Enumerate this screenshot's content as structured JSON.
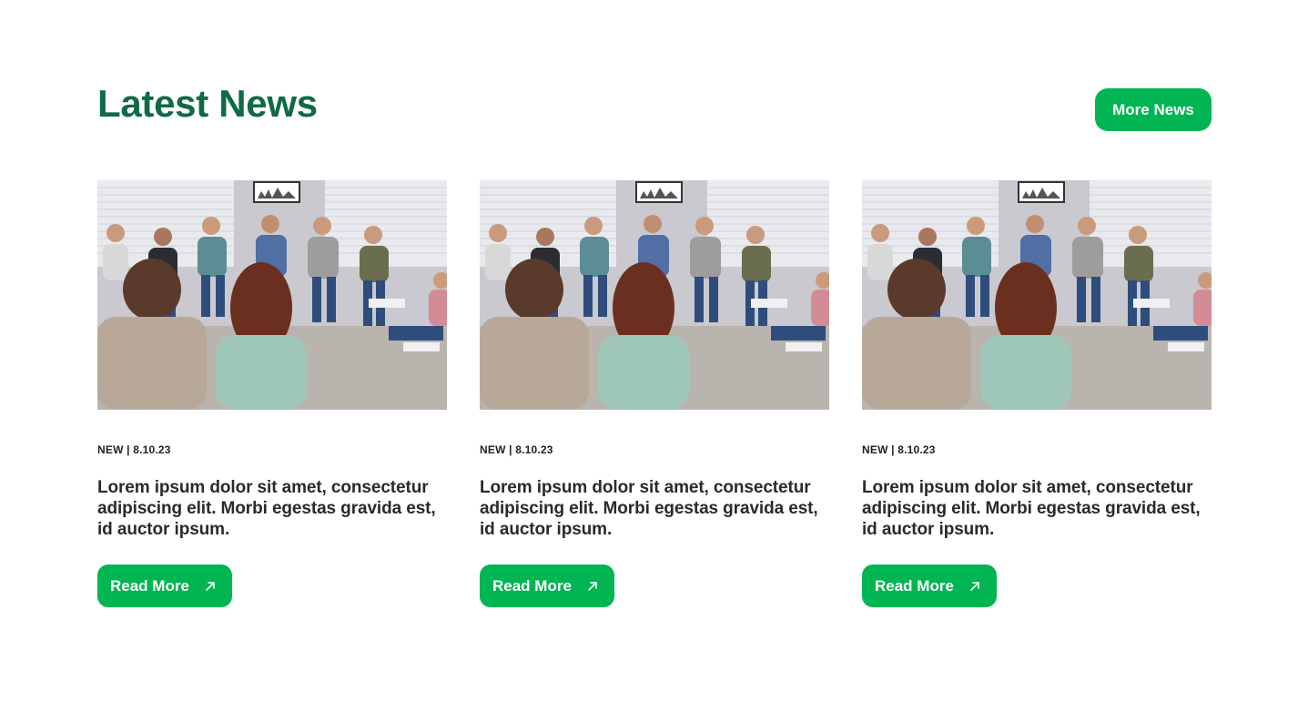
{
  "section": {
    "title": "Latest News",
    "more_button": "More News"
  },
  "articles": [
    {
      "meta": "NEW | 8.10.23",
      "headline": "Lorem ipsum dolor sit amet, consectetur adipiscing elit. Morbi egestas gravida est, id auctor ipsum.",
      "cta": "Read More",
      "image_alt": "support-group-photo"
    },
    {
      "meta": "NEW | 8.10.23",
      "headline": "Lorem ipsum dolor sit amet, consectetur adipiscing elit. Morbi egestas gravida est, id auctor ipsum.",
      "cta": "Read More",
      "image_alt": "support-group-photo"
    },
    {
      "meta": "NEW | 8.10.23",
      "headline": "Lorem ipsum dolor sit amet, consectetur adipiscing elit. Morbi egestas gravida est, id auctor ipsum.",
      "cta": "Read More",
      "image_alt": "support-group-photo"
    }
  ],
  "colors": {
    "title": "#0f6a45",
    "accent": "#00b552",
    "text": "#2a2a2a"
  },
  "icons": {
    "cta_icon": "arrow-up-right-icon"
  }
}
